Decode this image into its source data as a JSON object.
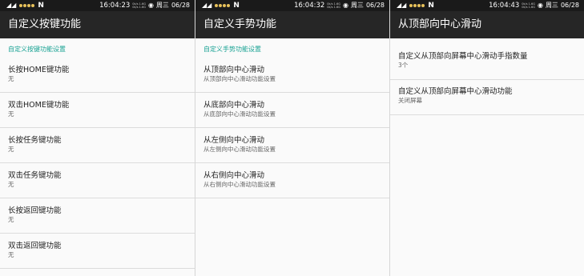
{
  "colors": {
    "statusbar_bg": "#1a1a1a",
    "appbar_bg": "#262626",
    "accent": "#1aa394",
    "background": "#fafafa"
  },
  "panels": [
    {
      "status": {
        "time": "16:04:23",
        "day": "周三",
        "date": "06/28",
        "tiny1": "0k/s 1.6G",
        "tiny2": "0k/s 1.6G"
      },
      "title": "自定义按键功能",
      "section": "自定义按键功能设置",
      "items": [
        {
          "title": "长按HOME键功能",
          "sub": "无"
        },
        {
          "title": "双击HOME键功能",
          "sub": "无"
        },
        {
          "title": "长按任务键功能",
          "sub": "无"
        },
        {
          "title": "双击任务键功能",
          "sub": "无"
        },
        {
          "title": "长按返回键功能",
          "sub": "无"
        },
        {
          "title": "双击返回键功能",
          "sub": "无"
        }
      ]
    },
    {
      "status": {
        "time": "16:04:32",
        "day": "周三",
        "date": "06/28",
        "tiny1": "0k/s 1.6G",
        "tiny2": "0k/s 1.6G"
      },
      "title": "自定义手势功能",
      "section": "自定义手势功能设置",
      "items": [
        {
          "title": "从顶部向中心滑动",
          "sub": "从顶部向中心滑动功能设置"
        },
        {
          "title": "从底部向中心滑动",
          "sub": "从底部向中心滑动功能设置"
        },
        {
          "title": "从左侧向中心滑动",
          "sub": "从左侧向中心滑动功能设置"
        },
        {
          "title": "从右侧向中心滑动",
          "sub": "从右侧向中心滑动功能设置"
        }
      ]
    },
    {
      "status": {
        "time": "16:04:43",
        "day": "周三",
        "date": "06/28",
        "tiny1": "0k/s 1.6G",
        "tiny2": "0k/s 1.6G"
      },
      "title": "从顶部向中心滑动",
      "items": [
        {
          "title": "自定义从顶部向屏幕中心滑动手指数量",
          "sub": "3个"
        },
        {
          "title": "自定义从顶部向屏幕中心滑动功能",
          "sub": "关闭屏幕"
        }
      ]
    }
  ],
  "icons": {
    "signal": "signal-icon",
    "notification_dots": "notification-dots-icon",
    "n_logo": "n-logo-icon",
    "battery": "battery-icon"
  }
}
